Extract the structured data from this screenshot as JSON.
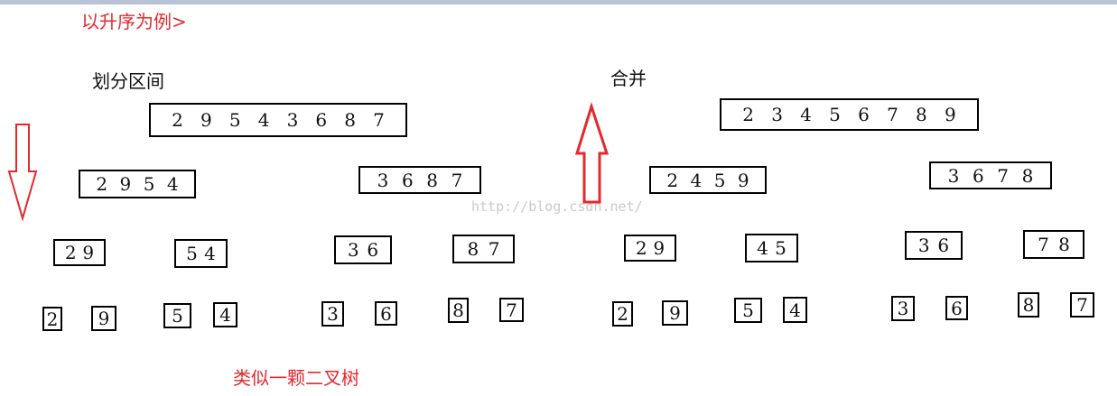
{
  "header_note": "以升序为例>",
  "split_title": "划分区间",
  "merge_title": "合并",
  "tree_note": "类似一颗二叉树",
  "watermark": "http://blog.csdn.net/",
  "colors": {
    "annotation": "#e5282d",
    "box_border": "#000000"
  },
  "split": {
    "level0": [
      "2 9 5 4 3 6 8 7"
    ],
    "level1": [
      "2 9 5 4",
      "3 6 8 7"
    ],
    "level2": [
      "2 9",
      "5 4",
      "3 6",
      "8 7"
    ],
    "level3": [
      "2",
      "9",
      "5",
      "4",
      "3",
      "6",
      "8",
      "7"
    ]
  },
  "merge": {
    "level0": [
      "2 3 4 5 6 7 8 9"
    ],
    "level1": [
      "2 4 5 9",
      "3 6 7 8"
    ],
    "level2": [
      "2 9",
      "4 5",
      "3 6",
      "7 8"
    ],
    "level3": [
      "2",
      "9",
      "5",
      "4",
      "3",
      "6",
      "8",
      "7"
    ]
  },
  "arrows": {
    "split_direction": "down",
    "merge_direction": "up"
  }
}
